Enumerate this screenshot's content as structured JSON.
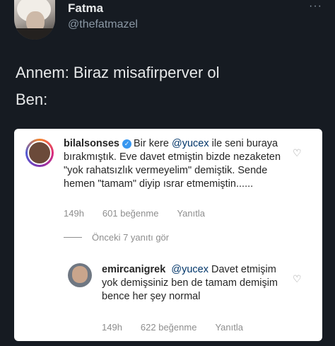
{
  "tweet": {
    "author_name": "Fatma",
    "author_handle": "@thefatmazel",
    "more_icon": "···",
    "lines": [
      "Annem: Biraz misafirperver ol",
      "Ben:"
    ]
  },
  "instagram_screenshot": {
    "comments": [
      {
        "username": "bilalsonses",
        "verified": true,
        "text_before_mention": "Bir kere ",
        "mention": "@yucex",
        "text_after_mention": " ile seni buraya bırakmıştık. Eve davet etmiştin bizde nezaketen \"yok rahatsızlık vermeyelim\" demiştik. Sende hemen \"tamam\" diyip ısrar etmemiştin......",
        "time": "149h",
        "likes": "601 beğenme",
        "reply_label": "Yanıtla"
      },
      {
        "username": "emircanigrek",
        "verified": false,
        "text_before_mention": "",
        "mention": "@yucex",
        "text_after_mention": " Davet etmişim yok demişsiniz ben de tamam demişim bence her şey normal",
        "time": "149h",
        "likes": "622 beğenme",
        "reply_label": "Yanıtla"
      }
    ],
    "view_replies": "Önceki 7 yanıtı gör",
    "heart_icon": "♡",
    "verified_icon": "✓"
  },
  "colors": {
    "background": "#161b22",
    "card": "#ffffff",
    "verified": "#3897f0",
    "secondary_text": "#8e8e8e"
  }
}
